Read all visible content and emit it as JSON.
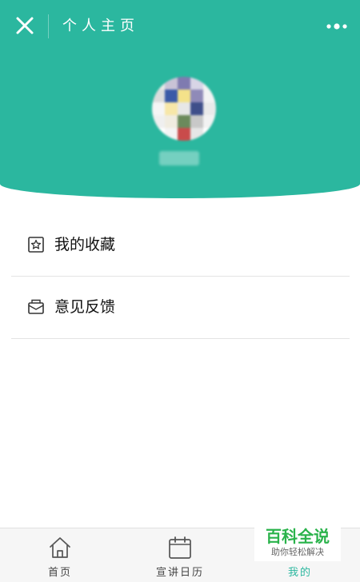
{
  "header": {
    "title": "个人主页",
    "close_icon": "close-icon",
    "more_icon": "more-dots-icon",
    "background_color": "#2bb79f",
    "avatar_colors": [
      "#e9e9e9",
      "#c9c3d6",
      "#7f7bb0",
      "#d8d5e6",
      "#f1f1f1",
      "#dcdcdc",
      "#3a5aa8",
      "#f4e28a",
      "#8f8ab8",
      "#f3f3f3",
      "#f5f5f5",
      "#f7e7a8",
      "#e7e7e7",
      "#3f4f8a",
      "#eaeaea",
      "#efefef",
      "#f0ece0",
      "#6b8a5c",
      "#c8c8c8",
      "#f2f2f2",
      "#ffffff",
      "#f4f4f4",
      "#c94b4b",
      "#e6e6e6",
      "#ffffff"
    ]
  },
  "menu": [
    {
      "label": "我的收藏",
      "icon": "favorites-star-icon"
    },
    {
      "label": "意见反馈",
      "icon": "feedback-envelope-icon"
    }
  ],
  "tabbar": {
    "tabs": [
      {
        "label": "首页",
        "icon": "home-icon",
        "active": false
      },
      {
        "label": "宣讲日历",
        "icon": "calendar-icon",
        "active": false
      },
      {
        "label": "我的",
        "icon": "profile-icon",
        "active": true
      }
    ],
    "active_color": "#2bb79f"
  },
  "watermark": {
    "title": "百科全说",
    "subtitle": "助你轻松解决",
    "color": "#2ab34b"
  }
}
